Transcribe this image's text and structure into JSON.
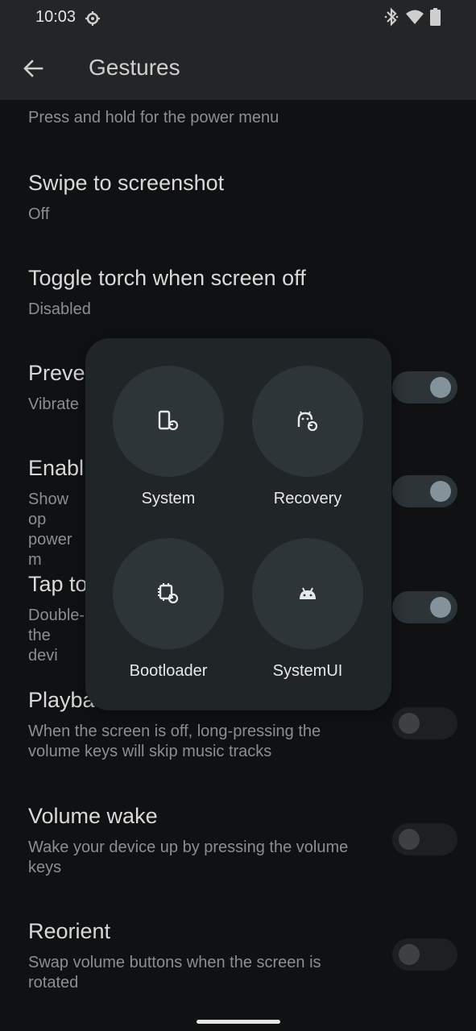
{
  "status_bar": {
    "time": "10:03",
    "icons": [
      "sync-settings-icon",
      "bluetooth-icon",
      "wifi-icon",
      "battery-icon"
    ]
  },
  "app_bar": {
    "title": "Gestures",
    "back_icon": "arrow-back-icon"
  },
  "settings": [
    {
      "title": "",
      "subtitle": "Press and hold for the power menu"
    },
    {
      "title": "Swipe to screenshot",
      "subtitle": "Off"
    },
    {
      "title": "Toggle torch when screen off",
      "subtitle": "Disabled"
    },
    {
      "title": "Preve",
      "subtitle": "Vibrate",
      "toggle": "on"
    },
    {
      "title": "Enabl",
      "subtitle": "Show op power m",
      "toggle": "on"
    },
    {
      "title": "Tap to",
      "subtitle": "Double- the devi",
      "toggle": "on"
    },
    {
      "title": "Playba",
      "subtitle": "When the screen is off, long-pressing the volume keys will skip music tracks",
      "toggle": "off"
    },
    {
      "title": "Volume wake",
      "subtitle": "Wake your device up by pressing the volume keys",
      "toggle": "off"
    },
    {
      "title": "Reorient",
      "subtitle": "Swap volume buttons when the screen is rotated",
      "toggle": "off"
    }
  ],
  "power_menu": {
    "options": [
      {
        "label": "System",
        "icon": "phone-restart-icon"
      },
      {
        "label": "Recovery",
        "icon": "android-restart-icon"
      },
      {
        "label": "Bootloader",
        "icon": "chip-restart-icon"
      },
      {
        "label": "SystemUI",
        "icon": "android-head-icon"
      }
    ]
  },
  "colors": {
    "background": "#0f1112",
    "bar": "#232526",
    "menu": "#202527",
    "menu_button": "#2e3538",
    "toggle_on_knob": "#84939b"
  }
}
